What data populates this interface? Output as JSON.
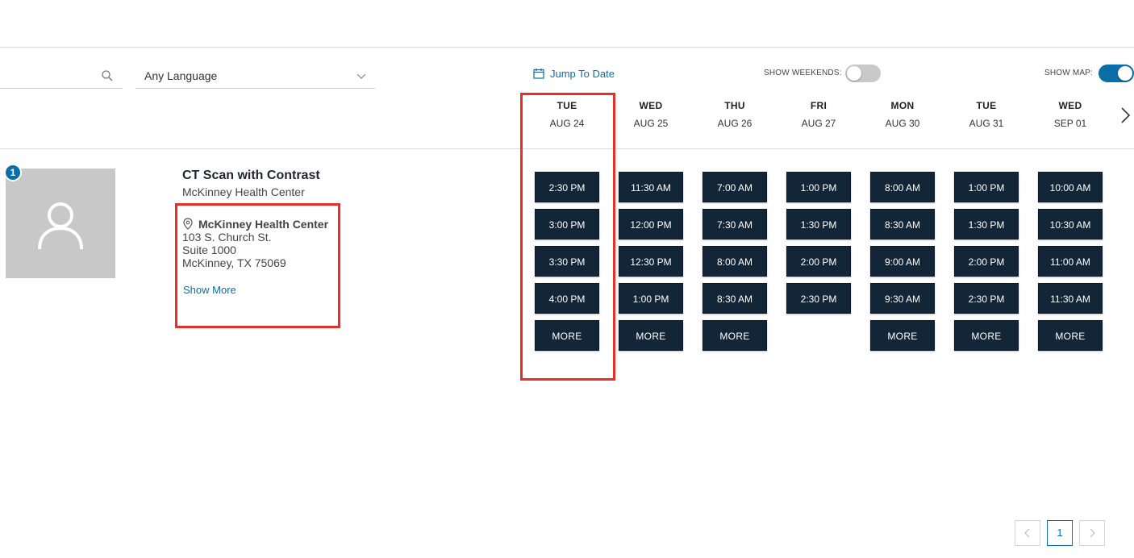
{
  "filters": {
    "search_value": "",
    "language": {
      "selected": "Any Language"
    },
    "jump_to_date": "Jump To Date",
    "show_weekends": {
      "label": "SHOW WEEKENDS:",
      "on": false
    },
    "show_map": {
      "label": "SHOW MAP:",
      "on": true
    }
  },
  "days": [
    {
      "dow": "TUE",
      "date": "AUG 24"
    },
    {
      "dow": "WED",
      "date": "AUG 25"
    },
    {
      "dow": "THU",
      "date": "AUG 26"
    },
    {
      "dow": "FRI",
      "date": "AUG 27"
    },
    {
      "dow": "MON",
      "date": "AUG 30"
    },
    {
      "dow": "TUE",
      "date": "AUG 31"
    },
    {
      "dow": "WED",
      "date": "SEP 01"
    }
  ],
  "provider": {
    "rank": "1",
    "service": "CT Scan with Contrast",
    "facility": "McKinney Health Center",
    "location": {
      "name": "McKinney Health Center",
      "line1": "103 S. Church St.",
      "line2": "Suite 1000",
      "line3": "McKinney, TX 75069"
    },
    "show_more": "Show More"
  },
  "slots": [
    [
      "2:30 PM",
      "3:00 PM",
      "3:30 PM",
      "4:00 PM"
    ],
    [
      "11:30 AM",
      "12:00 PM",
      "12:30 PM",
      "1:00 PM"
    ],
    [
      "7:00 AM",
      "7:30 AM",
      "8:00 AM",
      "8:30 AM"
    ],
    [
      "1:00 PM",
      "1:30 PM",
      "2:00 PM",
      "2:30 PM"
    ],
    [
      "8:00 AM",
      "8:30 AM",
      "9:00 AM",
      "9:30 AM"
    ],
    [
      "1:00 PM",
      "1:30 PM",
      "2:00 PM",
      "2:30 PM"
    ],
    [
      "10:00 AM",
      "10:30 AM",
      "11:00 AM",
      "11:30 AM"
    ]
  ],
  "more_label": "MORE",
  "more_visible": [
    true,
    true,
    true,
    false,
    true,
    true,
    true
  ],
  "pagination": {
    "current": "1"
  },
  "colors": {
    "accent": "#0a6fa8",
    "slot_bg": "#132637",
    "highlight": "#e8302b"
  }
}
